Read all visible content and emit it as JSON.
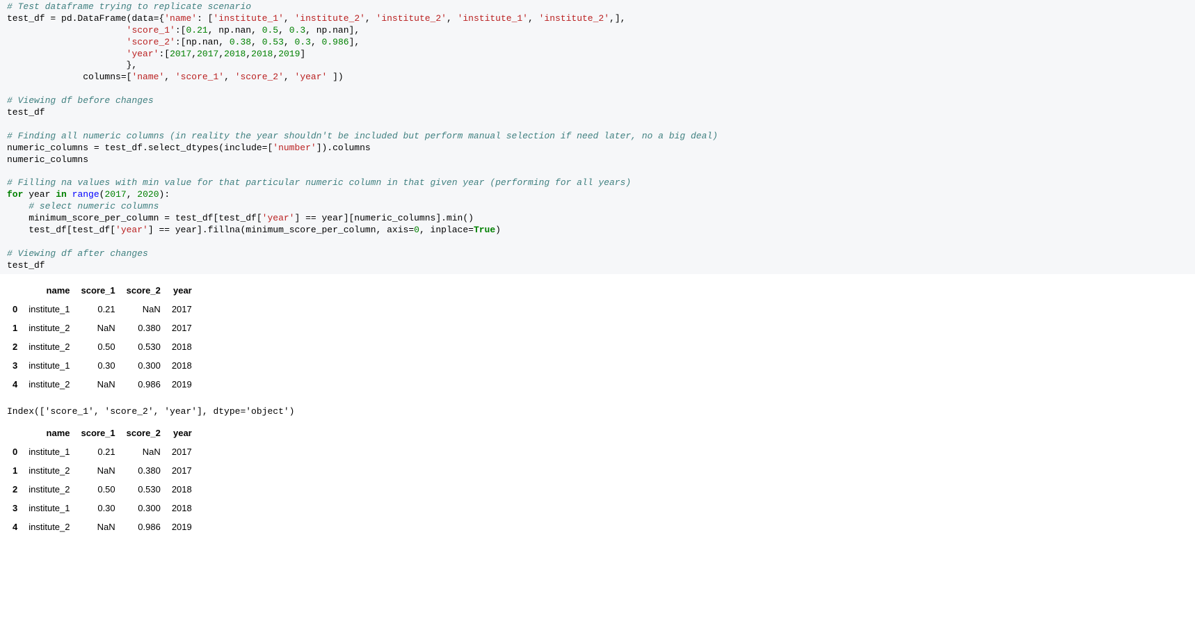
{
  "code": {
    "comment1": "# Test dataframe trying to replicate scenario",
    "line2a": "test_df = pd.",
    "line2b": "DataFrame",
    "line2c": "(data={",
    "line2d": "'name'",
    "line2e": ": [",
    "line2f": "'institute_1'",
    "line2g": ", ",
    "line2h": "'institute_2'",
    "line2i": ", ",
    "line2j": "'institute_2'",
    "line2k": ", ",
    "line2l": "'institute_1'",
    "line2m": ", ",
    "line2n": "'institute_2'",
    "line2o": ",],",
    "line3a": "                      ",
    "line3b": "'score_1'",
    "line3c": ":[",
    "line3d": "0.21",
    "line3e": ", np.nan, ",
    "line3f": "0.5",
    "line3g": ", ",
    "line3h": "0.3",
    "line3i": ", np.nan],",
    "line4a": "                      ",
    "line4b": "'score_2'",
    "line4c": ":[np.nan, ",
    "line4d": "0.38",
    "line4e": ", ",
    "line4f": "0.53",
    "line4g": ", ",
    "line4h": "0.3",
    "line4i": ", ",
    "line4j": "0.986",
    "line4k": "],",
    "line5a": "                      ",
    "line5b": "'year'",
    "line5c": ":[",
    "line5d": "2017",
    "line5e": ",",
    "line5f": "2017",
    "line5g": ",",
    "line5h": "2018",
    "line5i": ",",
    "line5j": "2018",
    "line5k": ",",
    "line5l": "2019",
    "line5m": "]",
    "line6": "                      },",
    "line7a": "              columns=[",
    "line7b": "'name'",
    "line7c": ", ",
    "line7d": "'score_1'",
    "line7e": ", ",
    "line7f": "'score_2'",
    "line7g": ", ",
    "line7h": "'year'",
    "line7i": " ])",
    "comment2": "# Viewing df before changes",
    "line9": "test_df",
    "comment3": "# Finding all numeric columns (in reality the year shouldn't be included but perform manual selection if need later, no a big deal)",
    "line11a": "numeric_columns = test_df.",
    "line11b": "select_dtypes",
    "line11c": "(include=[",
    "line11d": "'number'",
    "line11e": "]).columns",
    "line12": "numeric_columns",
    "comment4": "# Filling na values with min value for that particular numeric column in that given year (performing for all years)",
    "line14a": "for",
    "line14b": " year ",
    "line14c": "in",
    "line14d": " ",
    "line14e": "range",
    "line14f": "(",
    "line14g": "2017",
    "line14h": ", ",
    "line14i": "2020",
    "line14j": "):",
    "comment5": "    # select numeric columns",
    "line16a": "    minimum_score_per_column = test_df[test_df[",
    "line16b": "'year'",
    "line16c": "] == year][numeric_columns].",
    "line16d": "min",
    "line16e": "()",
    "line17a": "    test_df[test_df[",
    "line17b": "'year'",
    "line17c": "] == year].",
    "line17d": "fillna",
    "line17e": "(minimum_score_per_column, axis=",
    "line17f": "0",
    "line17g": ", inplace=",
    "line17h": "True",
    "line17i": ")",
    "comment6": "# Viewing df after changes",
    "line19": "test_df"
  },
  "table1": {
    "headers": [
      "",
      "name",
      "score_1",
      "score_2",
      "year"
    ],
    "rows": [
      [
        "0",
        "institute_1",
        "0.21",
        "NaN",
        "2017"
      ],
      [
        "1",
        "institute_2",
        "NaN",
        "0.380",
        "2017"
      ],
      [
        "2",
        "institute_2",
        "0.50",
        "0.530",
        "2018"
      ],
      [
        "3",
        "institute_1",
        "0.30",
        "0.300",
        "2018"
      ],
      [
        "4",
        "institute_2",
        "NaN",
        "0.986",
        "2019"
      ]
    ]
  },
  "index_output": "Index(['score_1', 'score_2', 'year'], dtype='object')",
  "table2": {
    "headers": [
      "",
      "name",
      "score_1",
      "score_2",
      "year"
    ],
    "rows": [
      [
        "0",
        "institute_1",
        "0.21",
        "NaN",
        "2017"
      ],
      [
        "1",
        "institute_2",
        "NaN",
        "0.380",
        "2017"
      ],
      [
        "2",
        "institute_2",
        "0.50",
        "0.530",
        "2018"
      ],
      [
        "3",
        "institute_1",
        "0.30",
        "0.300",
        "2018"
      ],
      [
        "4",
        "institute_2",
        "NaN",
        "0.986",
        "2019"
      ]
    ]
  }
}
